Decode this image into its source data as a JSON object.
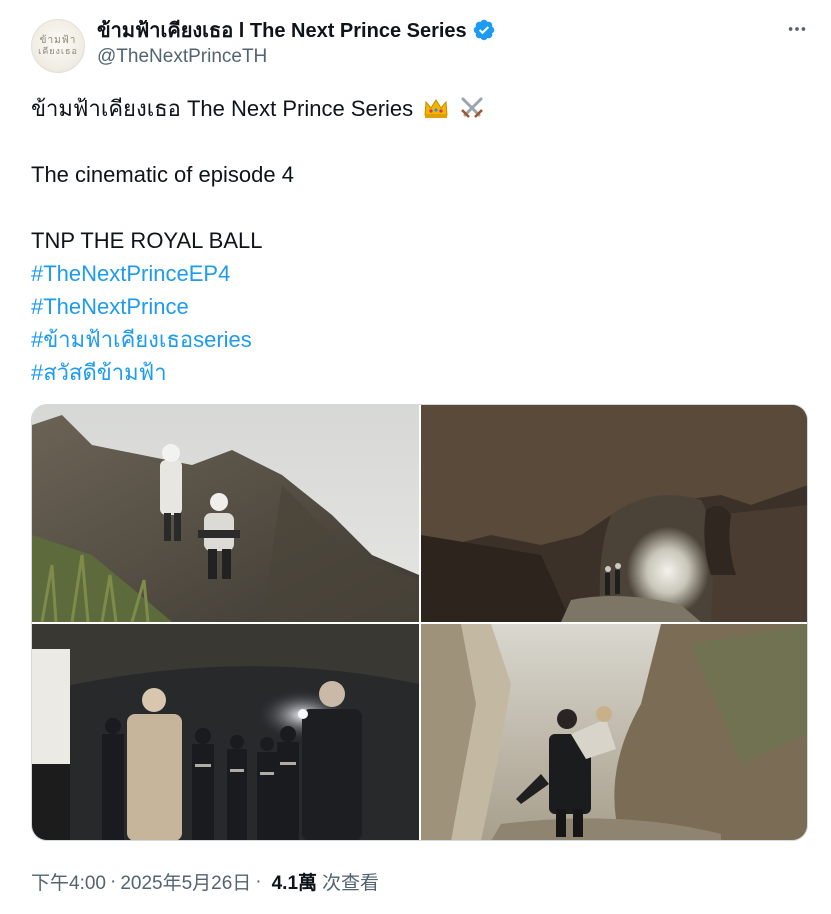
{
  "author": {
    "display_name": "ข้ามฟ้าเคียงเธอ l The Next Prince Series",
    "handle": "@TheNextPrinceTH",
    "avatar_text_line1": "ข้ามฟ้า",
    "avatar_text_line2": "เคียงเธอ",
    "verified": true,
    "verified_color": "#1d9bf0"
  },
  "tweet": {
    "lines": [
      {
        "text": "ข้ามฟ้าเคียงเธอ The Next Prince Series",
        "emoji": [
          "crown-emoji",
          "crossed-swords-emoji"
        ]
      },
      {
        "text": ""
      },
      {
        "text": "The cinematic of episode 4"
      },
      {
        "text": ""
      },
      {
        "text": "TNP THE ROYAL BALL"
      }
    ],
    "hashtags": [
      "#TheNextPrinceEP4",
      "#TheNextPrince",
      "#ข้ามฟ้าเคียงเธอseries",
      "#สวัสดีข้ามฟ้า"
    ],
    "hashtag_color": "#1d9bf0"
  },
  "media": {
    "photos": [
      {
        "id": "photo-1",
        "icon": "cliff-scene"
      },
      {
        "id": "photo-2",
        "icon": "cave-arch-scene"
      },
      {
        "id": "photo-3",
        "icon": "cave-guards-scene"
      },
      {
        "id": "photo-4",
        "icon": "canyon-carry-scene"
      }
    ]
  },
  "meta": {
    "time": "下午4:00",
    "separator": "·",
    "date": "2025年5月26日",
    "separator2": "·",
    "views_count": "4.1萬",
    "views_label": "次查看"
  },
  "more_icon": "more-horizontal-icon"
}
